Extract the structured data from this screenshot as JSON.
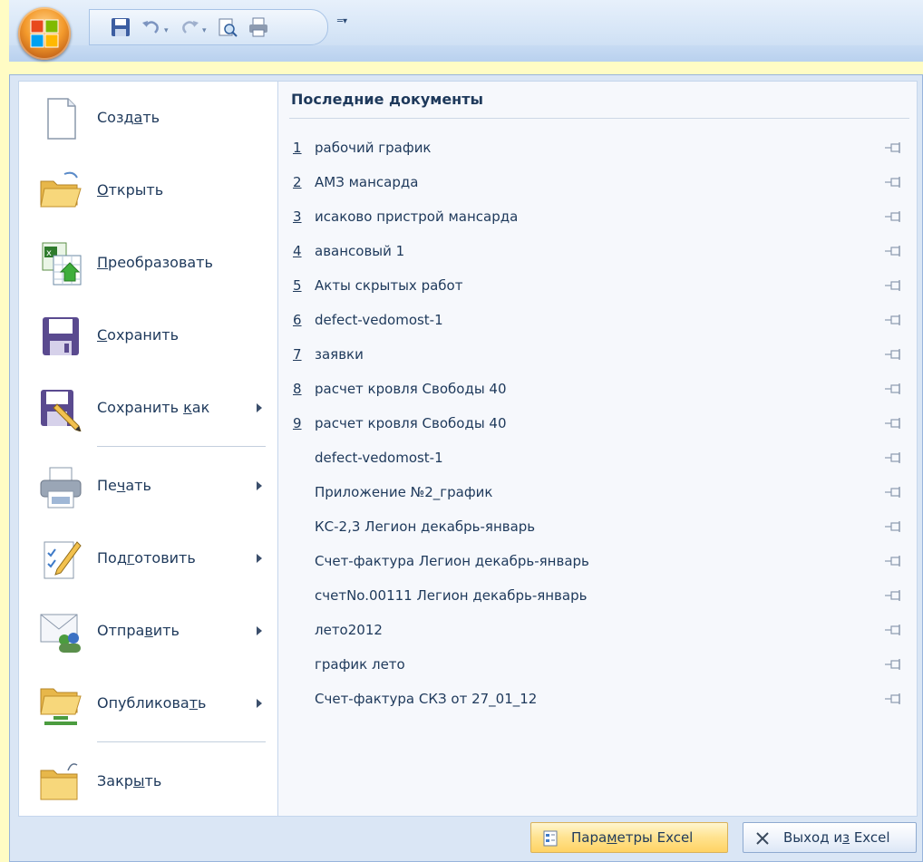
{
  "quick_access": {
    "icons": [
      "save-icon",
      "undo-icon",
      "redo-icon",
      "print-preview-icon",
      "quick-print-icon",
      "customize-toolbar-icon"
    ]
  },
  "commands": [
    {
      "pre": "Созд",
      "u": "а",
      "post": "ть",
      "icon": "new-document-icon",
      "submenu": false
    },
    {
      "pre": "",
      "u": "О",
      "post": "ткрыть",
      "icon": "open-folder-icon",
      "submenu": false
    },
    {
      "pre": "",
      "u": "П",
      "post": "реобразовать",
      "icon": "convert-icon",
      "submenu": false
    },
    {
      "pre": "",
      "u": "С",
      "post": "охранить",
      "icon": "save-icon",
      "submenu": false
    },
    {
      "pre": "Сохранить ",
      "u": "к",
      "post": "ак",
      "icon": "save-as-icon",
      "submenu": true
    },
    {
      "pre": "Пе",
      "u": "ч",
      "post": "ать",
      "icon": "print-icon",
      "submenu": true
    },
    {
      "pre": "Под",
      "u": "г",
      "post": "отовить",
      "icon": "prepare-icon",
      "submenu": true
    },
    {
      "pre": "Отпра",
      "u": "в",
      "post": "ить",
      "icon": "send-icon",
      "submenu": true
    },
    {
      "pre": "Опубликова",
      "u": "т",
      "post": "ь",
      "icon": "publish-icon",
      "submenu": true
    },
    {
      "pre": "Закр",
      "u": "ы",
      "post": "ть",
      "icon": "close-icon",
      "submenu": false
    }
  ],
  "recent": {
    "title": "Последние документы",
    "items": [
      {
        "num": "1",
        "name": "рабочий график"
      },
      {
        "num": "2",
        "name": "АМЗ мансарда"
      },
      {
        "num": "3",
        "name": "исаково пристрой мансарда"
      },
      {
        "num": "4",
        "name": "авансовый 1"
      },
      {
        "num": "5",
        "name": "Акты скрытых работ"
      },
      {
        "num": "6",
        "name": "defect-vedomost-1"
      },
      {
        "num": "7",
        "name": "заявки"
      },
      {
        "num": "8",
        "name": "расчет кровля Свободы 40"
      },
      {
        "num": "9",
        "name": "расчет кровля Свободы 40"
      },
      {
        "num": "",
        "name": "defect-vedomost-1"
      },
      {
        "num": "",
        "name": "Приложение №2_график"
      },
      {
        "num": "",
        "name": "КС-2,3 Легион декабрь-январь"
      },
      {
        "num": "",
        "name": "Счет-фактура Легион декабрь-январь"
      },
      {
        "num": "",
        "name": "счетNo.00111  Легион декабрь-январь"
      },
      {
        "num": "",
        "name": "лето2012"
      },
      {
        "num": "",
        "name": "график лето"
      },
      {
        "num": "",
        "name": "Счет-фактура СКЗ от 27_01_12"
      }
    ]
  },
  "bottom": {
    "options": {
      "pre": "Пара",
      "u": "м",
      "post": "етры Excel",
      "icon": "options-icon"
    },
    "exit": {
      "pre": "Выход и",
      "u": "з",
      "post": " Excel",
      "icon": "close-x-icon"
    }
  }
}
